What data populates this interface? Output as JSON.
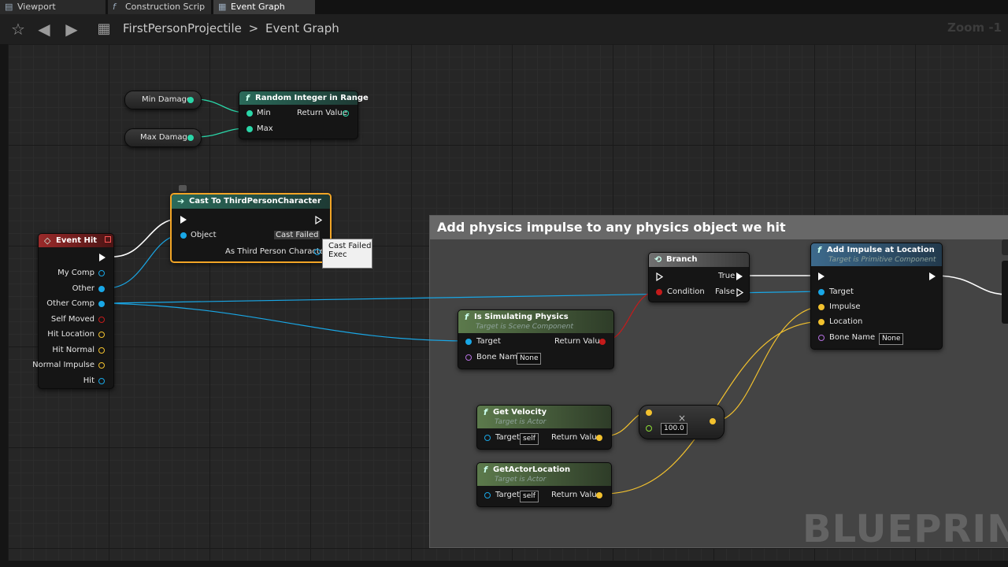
{
  "tabs": [
    {
      "label": "Viewport",
      "icon": "viewport-icon"
    },
    {
      "label": "Construction Scrip",
      "icon": "function-icon"
    },
    {
      "label": "Event Graph",
      "icon": "graph-icon"
    }
  ],
  "breadcrumb": {
    "blueprint": "FirstPersonProjectile",
    "separator": ">",
    "graph": "Event Graph"
  },
  "zoom": "Zoom -1",
  "comment": {
    "title": "Add physics impulse to any physics object we hit"
  },
  "nodes": {
    "min_damage": {
      "label": "Min Damage"
    },
    "max_damage": {
      "label": "Max Damage"
    },
    "random_integer": {
      "title": "Random Integer in Range",
      "min": "Min",
      "max": "Max",
      "return": "Return Value"
    },
    "cast": {
      "title": "Cast To ThirdPersonCharacter",
      "object": "Object",
      "cast_failed": "Cast Failed",
      "as_output": "As Third Person Character"
    },
    "tooltip": {
      "line1": "Cast Failed",
      "line2": "Exec"
    },
    "event_hit": {
      "title": "Event Hit",
      "pins": [
        "My Comp",
        "Other",
        "Other Comp",
        "Self Moved",
        "Hit Location",
        "Hit Normal",
        "Normal Impulse",
        "Hit"
      ]
    },
    "branch": {
      "title": "Branch",
      "condition": "Condition",
      "true": "True",
      "false": "False"
    },
    "add_impulse": {
      "title": "Add Impulse at Location",
      "subtitle": "Target is Primitive Component",
      "target": "Target",
      "impulse": "Impulse",
      "location": "Location",
      "bone_name": "Bone Name",
      "bone_value": "None"
    },
    "is_simulating": {
      "title": "Is Simulating Physics",
      "subtitle": "Target is Scene Component",
      "target": "Target",
      "return": "Return Value",
      "bone_name": "Bone Name",
      "bone_value": "None"
    },
    "get_velocity": {
      "title": "Get Velocity",
      "subtitle": "Target is Actor",
      "target": "Target",
      "self_value": "self",
      "return": "Return Value"
    },
    "get_actor_location": {
      "title": "GetActorLocation",
      "subtitle": "Target is Actor",
      "target": "Target",
      "self_value": "self",
      "return": "Return Value"
    },
    "multiply": {
      "value": "100.0",
      "operator": "×"
    }
  },
  "watermark": "BLUEPRINT",
  "colors": {
    "exec": "#ffffff",
    "integer": "#2ad6a8",
    "object": "#19a7e6",
    "vector": "#f2c12e",
    "boolean": "#c41b1b",
    "name": "#b56fe0",
    "float": "#8fe036"
  }
}
